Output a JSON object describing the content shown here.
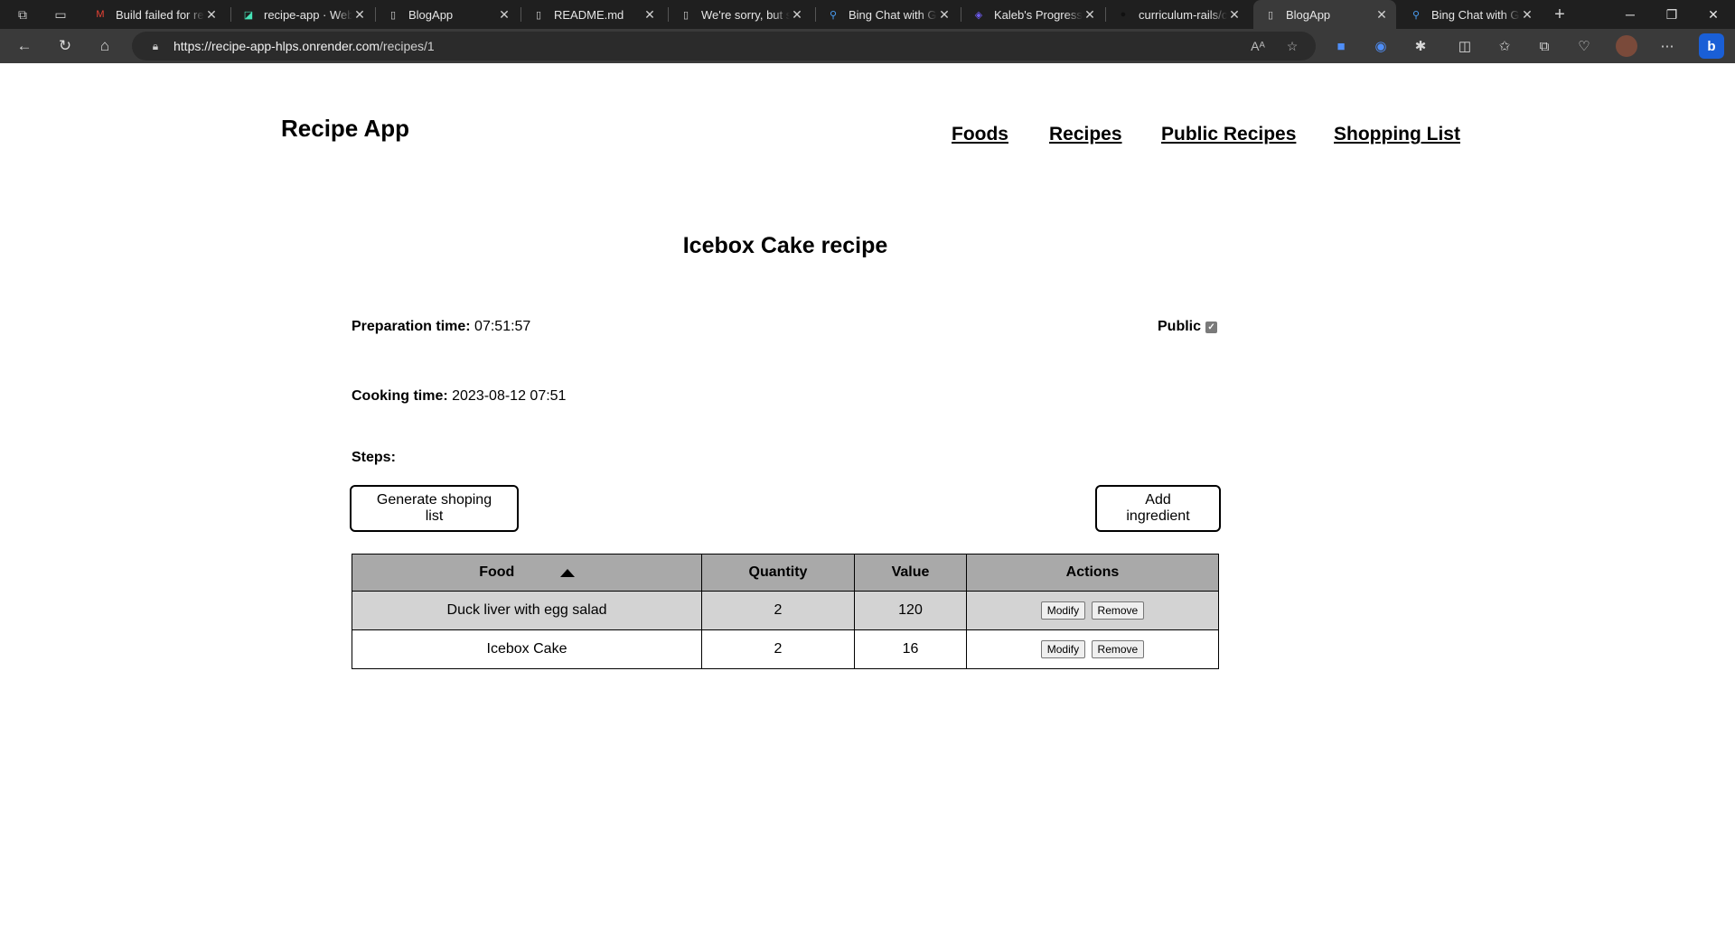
{
  "browser": {
    "tabs": [
      {
        "title": "Build failed for rec",
        "icon": "gmail-icon",
        "icon_color": "#ea4335"
      },
      {
        "title": "recipe-app · Web",
        "icon": "render-icon",
        "icon_color": "#46e3b7"
      },
      {
        "title": "BlogApp",
        "icon": "page-icon",
        "icon_color": "#cfcfcf"
      },
      {
        "title": "README.md",
        "icon": "page-icon",
        "icon_color": "#cfcfcf"
      },
      {
        "title": "We're sorry, but so",
        "icon": "page-icon",
        "icon_color": "#cfcfcf"
      },
      {
        "title": "Bing Chat with GP",
        "icon": "bing-search-icon",
        "icon_color": "#4a9ef5"
      },
      {
        "title": "Kaleb's Progress",
        "icon": "microverse-icon",
        "icon_color": "#6f5cf2"
      },
      {
        "title": "curriculum-rails/c",
        "icon": "github-icon",
        "icon_color": "#111111"
      },
      {
        "title": "BlogApp",
        "icon": "page-icon",
        "icon_color": "#cfcfcf",
        "active": true
      },
      {
        "title": "Bing Chat with GP",
        "icon": "bing-search-icon",
        "icon_color": "#4a9ef5"
      }
    ],
    "url_host": "https://recipe-app-hlps.onrender.com",
    "url_path": "/recipes/1"
  },
  "header": {
    "brand": "Recipe App",
    "nav": [
      "Foods",
      "Recipes",
      "Public Recipes",
      "Shopping List"
    ]
  },
  "recipe": {
    "title": "Icebox Cake recipe",
    "prep_label": "Preparation time:",
    "prep_value": "07:51:57",
    "cook_label": "Cooking time:",
    "cook_value": "2023-08-12 07:51",
    "steps_label": "Steps:",
    "public_label": "Public",
    "public_checked": true
  },
  "actions": {
    "generate": "Generate shoping list",
    "add": "Add ingredient"
  },
  "table": {
    "headers": [
      "Food",
      "Quantity",
      "Value",
      "Actions"
    ],
    "sort_column": "Food",
    "rows": [
      {
        "food": "Duck liver with egg salad",
        "quantity": "2",
        "value": "120"
      },
      {
        "food": "Icebox Cake",
        "quantity": "2",
        "value": "16"
      }
    ],
    "modify_label": "Modify",
    "remove_label": "Remove"
  }
}
